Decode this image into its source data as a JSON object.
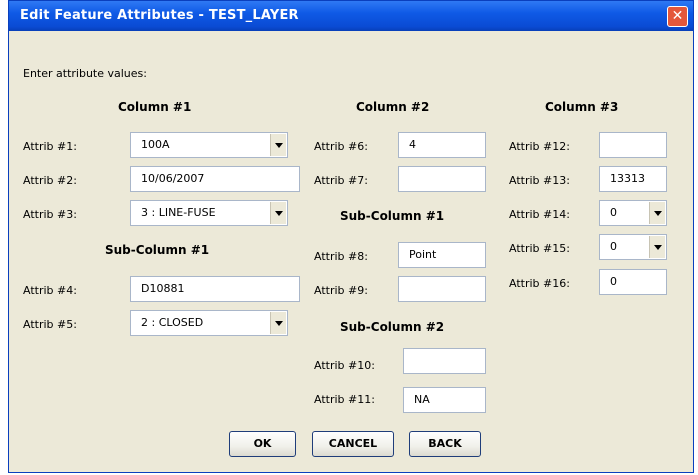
{
  "window": {
    "title": "Edit Feature Attributes - TEST_LAYER",
    "close_icon": "close-icon"
  },
  "prompt": "Enter attribute values:",
  "column1": {
    "header": "Column #1",
    "attrib1": {
      "label": "Attrib #1:",
      "value": "100A"
    },
    "attrib2": {
      "label": "Attrib #2:",
      "value": "10/06/2007"
    },
    "attrib3": {
      "label": "Attrib #3:",
      "value": "3 : LINE-FUSE"
    },
    "sub_header": "Sub-Column #1",
    "attrib4": {
      "label": "Attrib #4:",
      "value": "D10881"
    },
    "attrib5": {
      "label": "Attrib #5:",
      "value": "2 : CLOSED"
    }
  },
  "column2": {
    "header": "Column #2",
    "attrib6": {
      "label": "Attrib #6:",
      "value": "4"
    },
    "attrib7": {
      "label": "Attrib #7:",
      "value": ""
    },
    "sub1_header": "Sub-Column #1",
    "attrib8": {
      "label": "Attrib #8:",
      "value": "Point"
    },
    "attrib9": {
      "label": "Attrib #9:",
      "value": ""
    },
    "sub2_header": "Sub-Column #2",
    "attrib10": {
      "label": "Attrib #10:",
      "value": ""
    },
    "attrib11": {
      "label": "Attrib #11:",
      "value": "NA"
    }
  },
  "column3": {
    "header": "Column #3",
    "attrib12": {
      "label": "Attrib #12:",
      "value": ""
    },
    "attrib13": {
      "label": "Attrib #13:",
      "value": "13313"
    },
    "attrib14": {
      "label": "Attrib #14:",
      "value": "0"
    },
    "attrib15": {
      "label": "Attrib #15:",
      "value": "0"
    },
    "attrib16": {
      "label": "Attrib #16:",
      "value": "0"
    }
  },
  "buttons": {
    "ok": "OK",
    "cancel": "CANCEL",
    "back": "BACK"
  }
}
